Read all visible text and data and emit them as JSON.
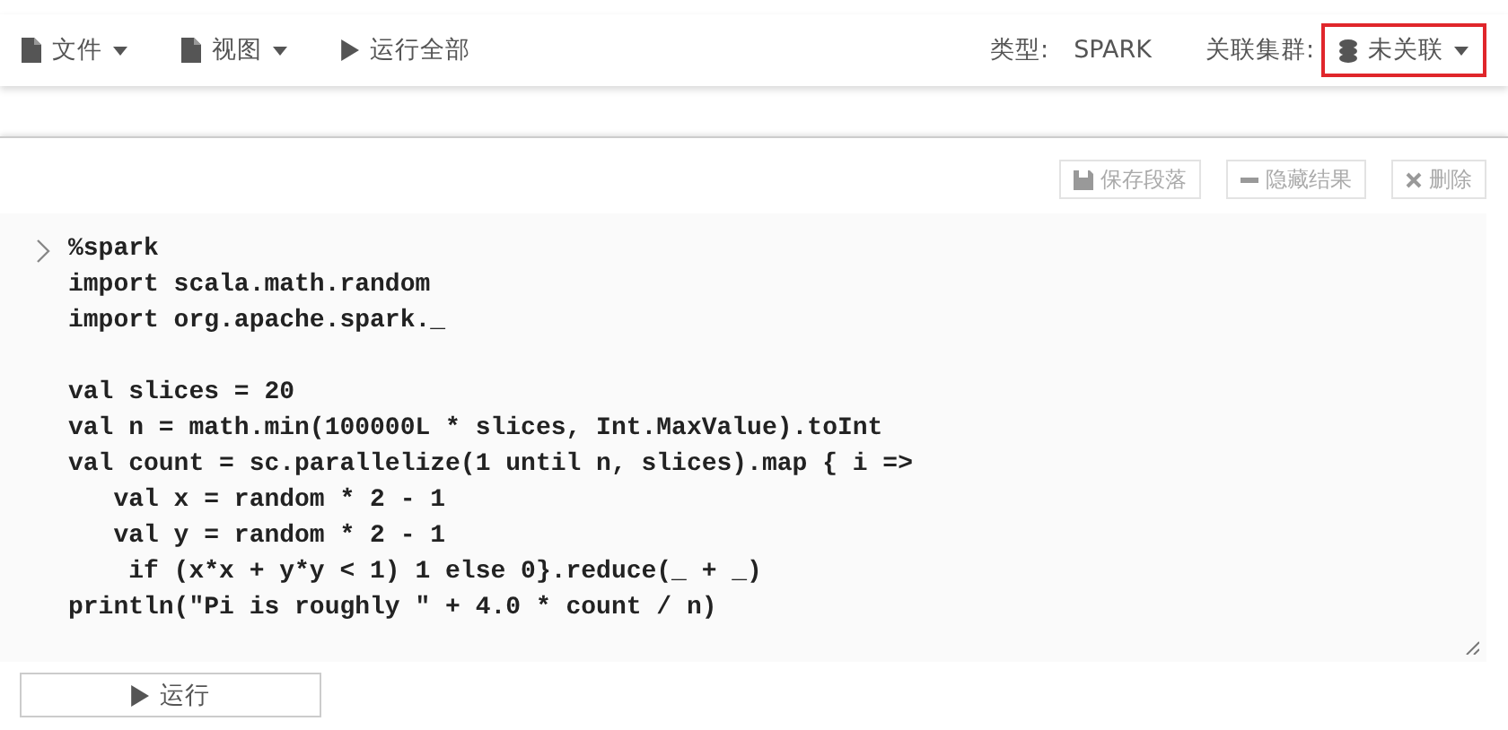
{
  "toolbar": {
    "menus": [
      {
        "label": "文件",
        "kind": "dropdown"
      },
      {
        "label": "视图",
        "kind": "dropdown"
      },
      {
        "label": "运行全部",
        "kind": "run"
      }
    ],
    "type_label": "类型:",
    "type_value": "SPARK",
    "cluster_label": "关联集群:",
    "cluster": {
      "value": "未关联",
      "highlighted": true
    }
  },
  "paragraph": {
    "actions": [
      {
        "label": "保存段落",
        "kind": "save"
      },
      {
        "label": "隐藏结果",
        "kind": "hide"
      },
      {
        "label": "删除",
        "kind": "delete"
      }
    ],
    "code": "%spark\nimport scala.math.random\nimport org.apache.spark._\n\nval slices = 20\nval n = math.min(100000L * slices, Int.MaxValue).toInt\nval count = sc.parallelize(1 until n, slices).map { i =>\n   val x = random * 2 - 1\n   val y = random * 2 - 1\n    if (x*x + y*y < 1) 1 else 0}.reduce(_ + _)\nprintln(\"Pi is roughly \" + 4.0 * count / n)",
    "run_button": "运行"
  }
}
